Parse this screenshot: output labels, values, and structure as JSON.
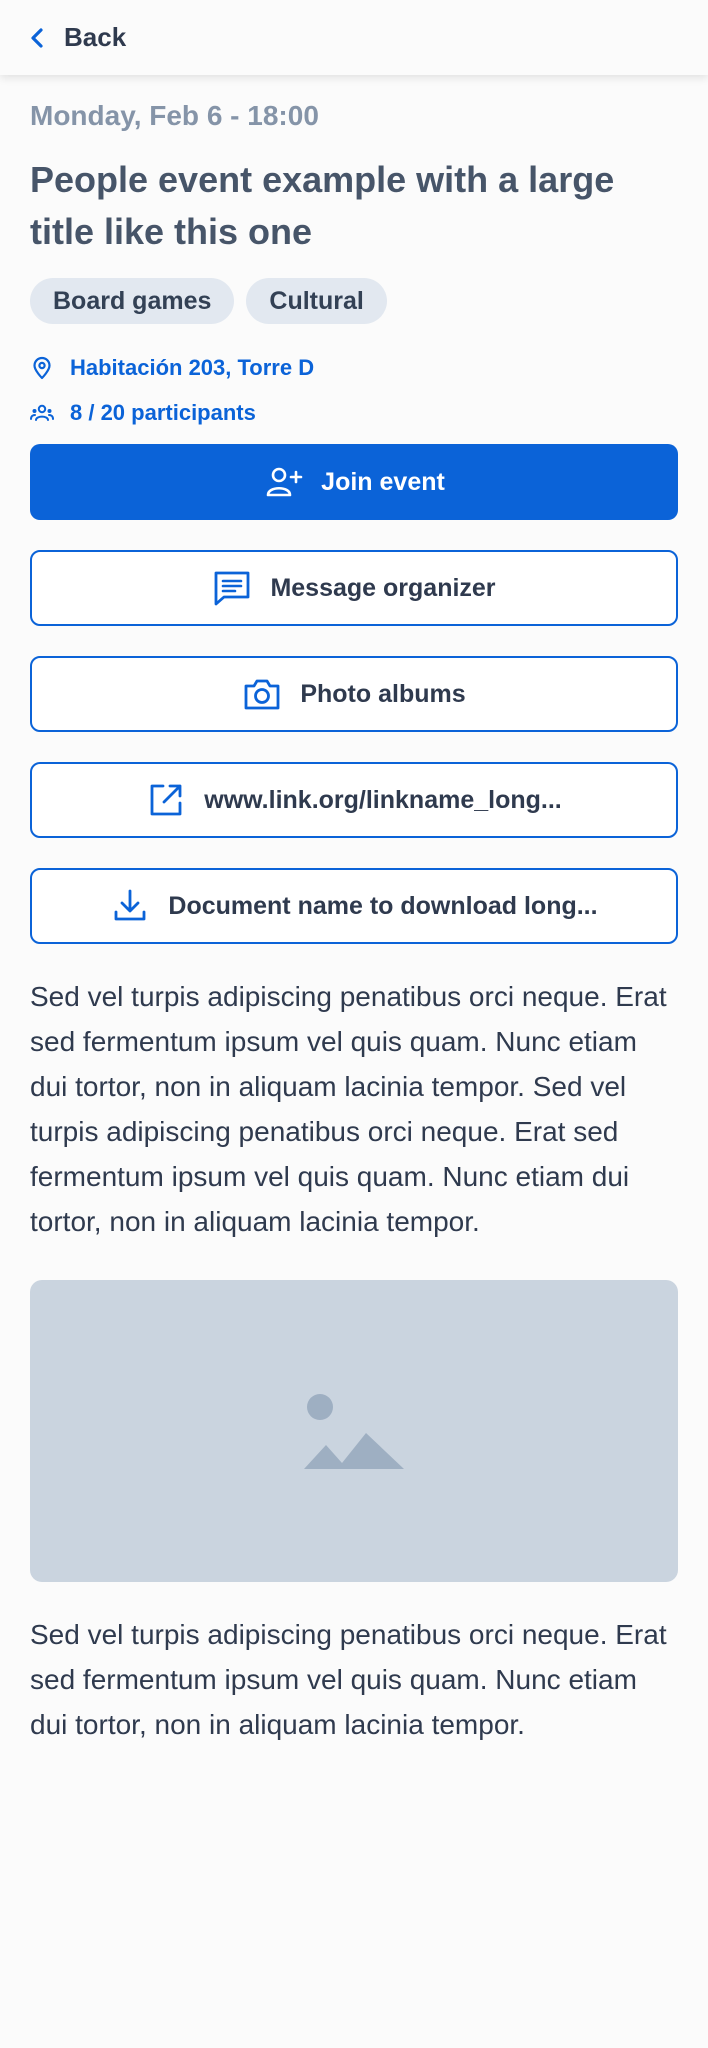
{
  "nav": {
    "back_label": "Back"
  },
  "event": {
    "date": "Monday, Feb 6 - 18:00",
    "title": "People event example with a large title like this one",
    "tags": [
      "Board games",
      "Cultural"
    ],
    "location": "Habitación 203, Torre D",
    "participants": "8 / 20 participants"
  },
  "actions": {
    "join": "Join event",
    "message": "Message organizer",
    "photos": "Photo albums",
    "link": "www.link.org/linkname_long...",
    "document": "Document name to download long..."
  },
  "body": {
    "paragraph1": "Sed vel turpis adipiscing penatibus orci neque. Erat sed fermentum ipsum vel quis quam. Nunc etiam dui tortor, non in aliquam lacinia tempor. Sed vel turpis adipiscing penatibus orci neque. Erat sed fermentum ipsum vel quis quam. Nunc etiam dui tortor, non in aliquam lacinia tempor.",
    "paragraph2": "Sed vel turpis adipiscing penatibus orci neque. Erat sed fermentum ipsum vel quis quam. Nunc etiam dui tortor, non in aliquam lacinia tempor."
  },
  "icons": {
    "back": "chevron-left-icon",
    "location": "map-pin-icon",
    "participants": "users-icon",
    "join": "user-plus-icon",
    "message": "message-icon",
    "photos": "camera-icon",
    "link": "external-link-icon",
    "document": "download-icon",
    "image": "image-placeholder-icon"
  },
  "colors": {
    "primary": "#0b63d8",
    "tag_bg": "#e2e8f0",
    "placeholder_bg": "#cad4df",
    "text": "#2f3a4e",
    "muted": "#8594a8"
  }
}
